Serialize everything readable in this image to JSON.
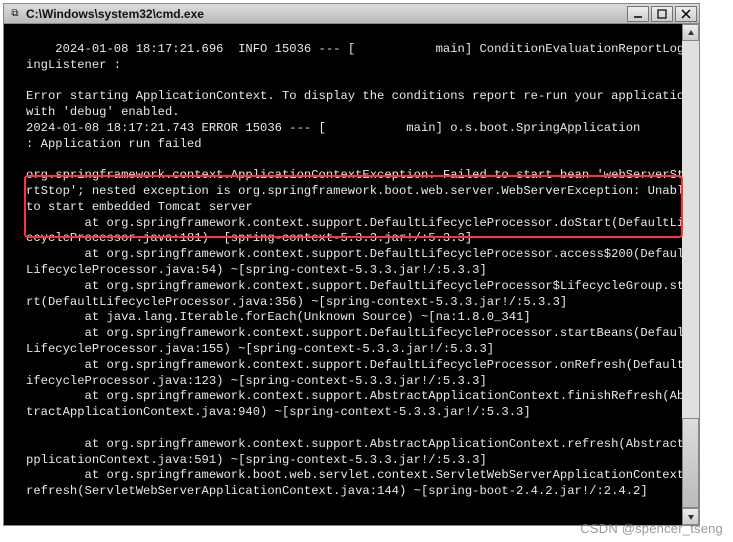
{
  "window": {
    "title": "C:\\Windows\\system32\\cmd.exe",
    "icon": "⧉"
  },
  "console_text": "2024-01-08 18:17:21.696  INFO 15036 --- [           main] ConditionEvaluationReportLoggingListener :\n\nError starting ApplicationContext. To display the conditions report re-run your application with 'debug' enabled.\n2024-01-08 18:17:21.743 ERROR 15036 --- [           main] o.s.boot.SpringApplication               : Application run failed\n\norg.springframework.context.ApplicationContextException: Failed to start bean 'webServerStartStop'; nested exception is org.springframework.boot.web.server.WebServerException: Unable to start embedded Tomcat server\n        at org.springframework.context.support.DefaultLifecycleProcessor.doStart(DefaultLifecycleProcessor.java:181) ~[spring-context-5.3.3.jar!/:5.3.3]\n        at org.springframework.context.support.DefaultLifecycleProcessor.access$200(DefaultLifecycleProcessor.java:54) ~[spring-context-5.3.3.jar!/:5.3.3]\n        at org.springframework.context.support.DefaultLifecycleProcessor$LifecycleGroup.start(DefaultLifecycleProcessor.java:356) ~[spring-context-5.3.3.jar!/:5.3.3]\n        at java.lang.Iterable.forEach(Unknown Source) ~[na:1.8.0_341]\n        at org.springframework.context.support.DefaultLifecycleProcessor.startBeans(DefaultLifecycleProcessor.java:155) ~[spring-context-5.3.3.jar!/:5.3.3]\n        at org.springframework.context.support.DefaultLifecycleProcessor.onRefresh(DefaultLifecycleProcessor.java:123) ~[spring-context-5.3.3.jar!/:5.3.3]\n        at org.springframework.context.support.AbstractApplicationContext.finishRefresh(AbstractApplicationContext.java:940) ~[spring-context-5.3.3.jar!/:5.3.3]\n\n        at org.springframework.context.support.AbstractApplicationContext.refresh(AbstractApplicationContext.java:591) ~[spring-context-5.3.3.jar!/:5.3.3]\n        at org.springframework.boot.web.servlet.context.ServletWebServerApplicationContext.refresh(ServletWebServerApplicationContext.java:144) ~[spring-boot-2.4.2.jar!/:2.4.2]",
  "watermark": "CSDN @spencer_tseng",
  "highlighted_error": "org.springframework.context.ApplicationContextException: Failed to start bean 'webServerStartStop'; nested exception is org.springframework.boot.web.server.WebServerException: Unable to start embedded Tomcat server"
}
